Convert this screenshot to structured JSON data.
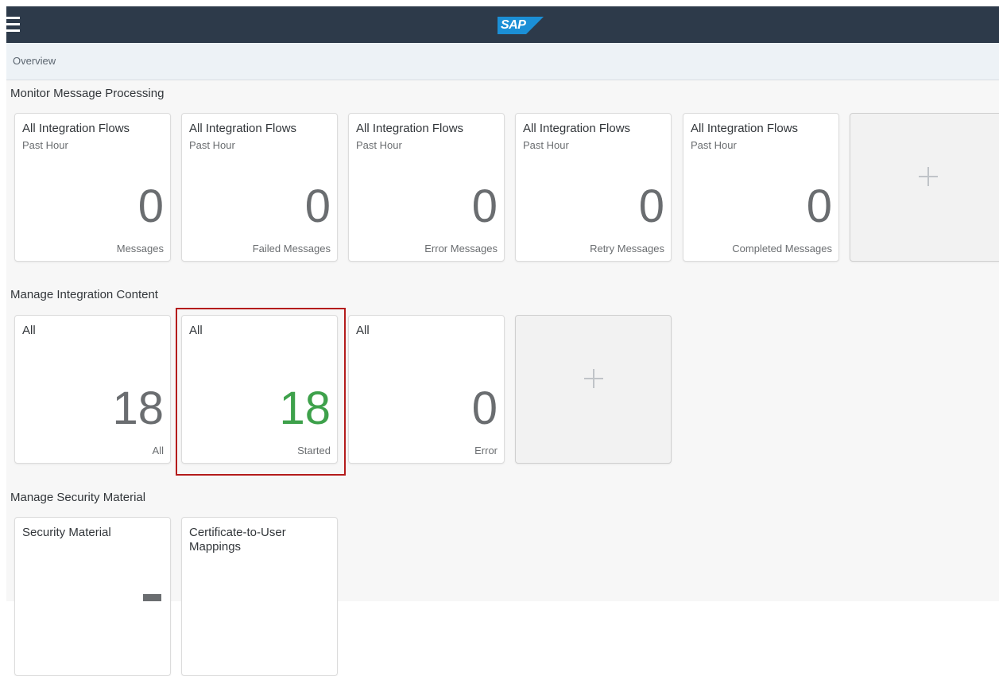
{
  "header": {
    "logo_text": "SAP",
    "brand_color": "#2d3a4a"
  },
  "breadcrumb": "Overview",
  "sections": {
    "monitor": {
      "title": "Monitor Message Processing",
      "tiles": [
        {
          "title": "All Integration Flows",
          "subtitle": "Past Hour",
          "value": "0",
          "unit": "Messages"
        },
        {
          "title": "All Integration Flows",
          "subtitle": "Past Hour",
          "value": "0",
          "unit": "Failed Messages"
        },
        {
          "title": "All Integration Flows",
          "subtitle": "Past Hour",
          "value": "0",
          "unit": "Error Messages"
        },
        {
          "title": "All Integration Flows",
          "subtitle": "Past Hour",
          "value": "0",
          "unit": "Retry Messages"
        },
        {
          "title": "All Integration Flows",
          "subtitle": "Past Hour",
          "value": "0",
          "unit": "Completed Messages"
        }
      ]
    },
    "manage": {
      "title": "Manage Integration Content",
      "tiles": [
        {
          "title": "All",
          "value": "18",
          "unit": "All"
        },
        {
          "title": "All",
          "value": "18",
          "unit": "Started",
          "value_color": "#3ea14b"
        },
        {
          "title": "All",
          "value": "0",
          "unit": "Error"
        }
      ]
    },
    "security": {
      "title": "Manage Security Material",
      "tiles": [
        {
          "title": "Security Material"
        },
        {
          "title": "Certificate-to-User Mappings"
        }
      ]
    }
  },
  "highlight_color": "#b41c1c"
}
